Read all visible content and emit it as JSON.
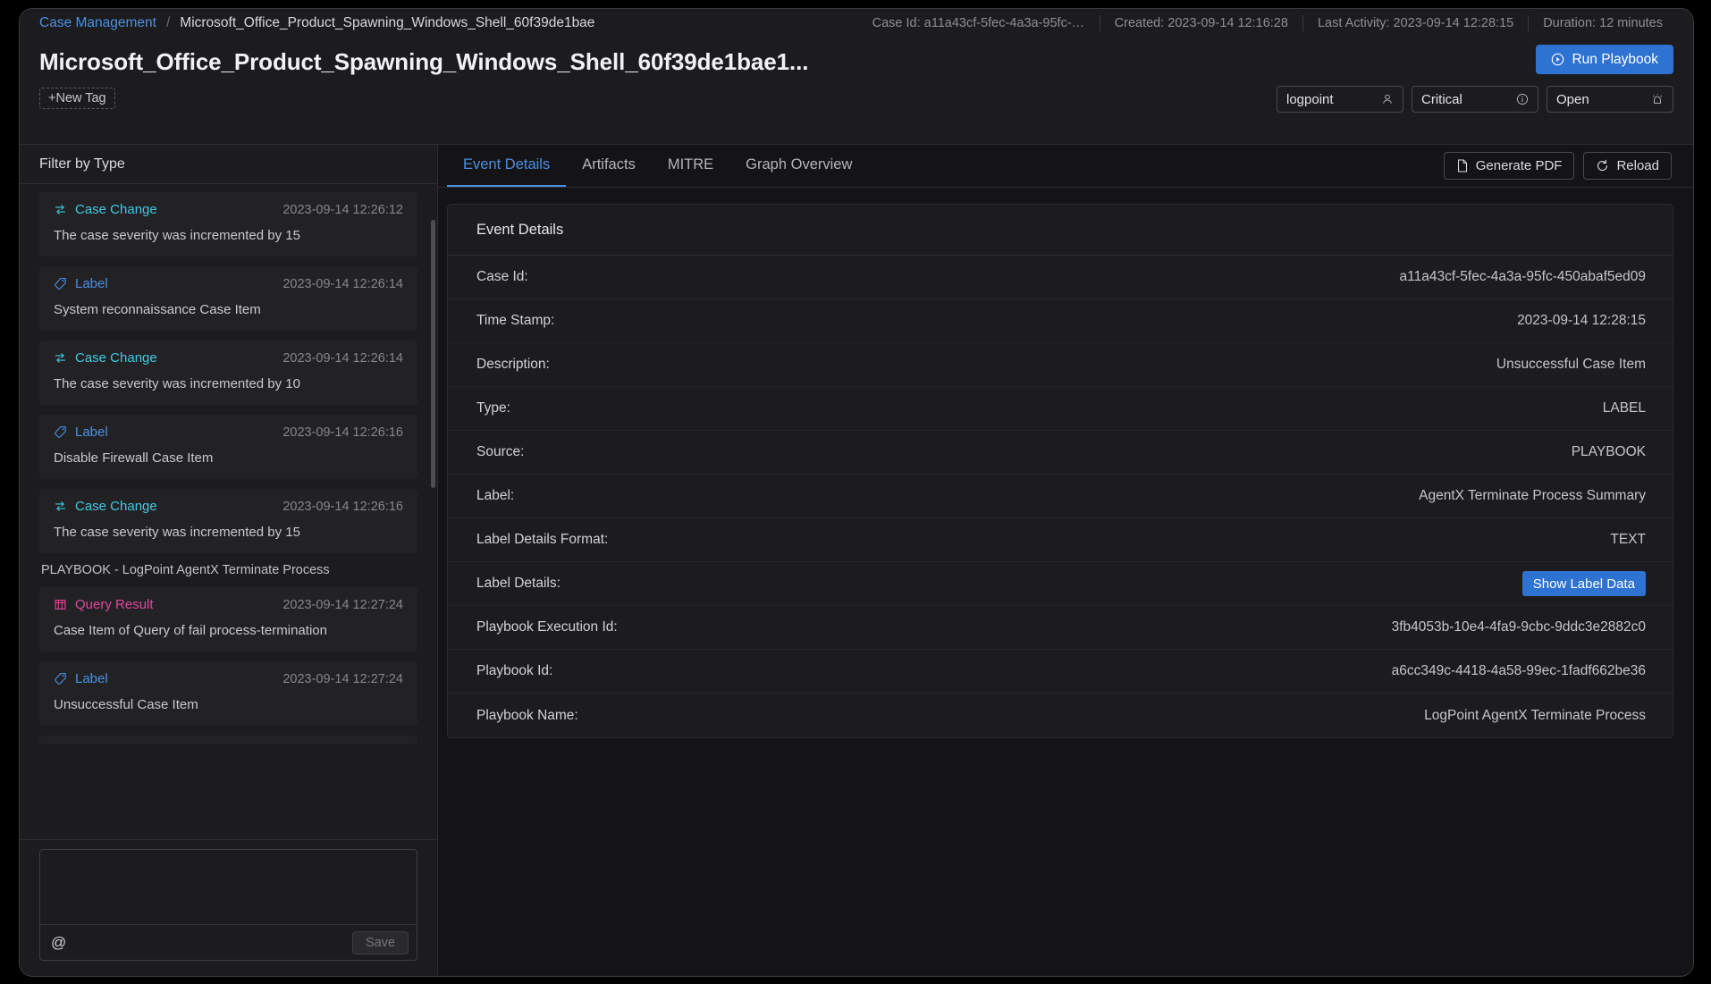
{
  "breadcrumb": {
    "root_label": "Case Management",
    "separator": "/",
    "current_label": "Microsoft_Office_Product_Spawning_Windows_Shell_60f39de1bae"
  },
  "header_meta": {
    "case_id": "Case Id: a11a43cf-5fec-4a3a-95fc-4...",
    "created": "Created: 2023-09-14 12:16:28",
    "last_activity": "Last Activity: 2023-09-14 12:28:15",
    "duration": "Duration: 12 minutes"
  },
  "title": {
    "text": "Microsoft_Office_Product_Spawning_Windows_Shell_60f39de1bae1...",
    "new_tag_label": "+New Tag"
  },
  "actions": {
    "run_playbook_label": "Run Playbook",
    "run_playbook_icon": "play-circle-icon",
    "accent_color": "#2e72d2"
  },
  "selectors": [
    {
      "name": "assignee",
      "value": "logpoint",
      "icon": "user-icon"
    },
    {
      "name": "severity",
      "value": "Critical",
      "icon": "info-circle-icon"
    },
    {
      "name": "status",
      "value": "Open",
      "icon": "alarm-icon"
    }
  ],
  "sidebar": {
    "filter_header": "Filter by Type",
    "group_title": "PLAYBOOK - LogPoint AgentX Terminate Process",
    "items": [
      {
        "type": "Case Change",
        "type_class": "casechange",
        "icon": "swap-icon",
        "time": "2023-09-14 12:26:12",
        "description": "The case severity was incremented by 15"
      },
      {
        "type": "Label",
        "type_class": "label",
        "icon": "tag-icon",
        "time": "2023-09-14 12:26:14",
        "description": "System reconnaissance Case Item"
      },
      {
        "type": "Case Change",
        "type_class": "casechange",
        "icon": "swap-icon",
        "time": "2023-09-14 12:26:14",
        "description": "The case severity was incremented by 10"
      },
      {
        "type": "Label",
        "type_class": "label",
        "icon": "tag-icon",
        "time": "2023-09-14 12:26:16",
        "description": "Disable Firewall Case Item"
      },
      {
        "type": "Case Change",
        "type_class": "casechange",
        "icon": "swap-icon",
        "time": "2023-09-14 12:26:16",
        "description": "The case severity was incremented by 15"
      }
    ],
    "group_items": [
      {
        "type": "Query Result",
        "type_class": "query",
        "icon": "table-icon",
        "time": "2023-09-14 12:27:24",
        "description": "Case Item of Query of fail process-termination"
      },
      {
        "type": "Label",
        "type_class": "label",
        "icon": "tag-icon",
        "time": "2023-09-14 12:27:24",
        "description": "Unsuccessful Case Item"
      }
    ],
    "composer": {
      "value": "",
      "placeholder": "",
      "mention_label": "@",
      "save_label": "Save"
    }
  },
  "main": {
    "tabs": [
      {
        "label": "Event Details",
        "active": true
      },
      {
        "label": "Artifacts",
        "active": false
      },
      {
        "label": "MITRE",
        "active": false
      },
      {
        "label": "Graph Overview",
        "active": false
      }
    ],
    "tab_actions": [
      {
        "label": "Generate PDF",
        "icon": "file-pdf-icon"
      },
      {
        "label": "Reload",
        "icon": "refresh-icon"
      }
    ],
    "card_title": "Event Details",
    "rows": [
      {
        "key": "Case Id:",
        "value": "a11a43cf-5fec-4a3a-95fc-450abaf5ed09"
      },
      {
        "key": "Time Stamp:",
        "value": "2023-09-14 12:28:15"
      },
      {
        "key": "Description:",
        "value": "Unsuccessful Case Item"
      },
      {
        "key": "Type:",
        "value": "LABEL"
      },
      {
        "key": "Source:",
        "value": "PLAYBOOK"
      },
      {
        "key": "Label:",
        "value": "AgentX Terminate Process Summary"
      },
      {
        "key": "Label Details Format:",
        "value": "TEXT"
      },
      {
        "key": "Label Details:",
        "value": "",
        "button": "Show Label Data"
      },
      {
        "key": "Playbook Execution Id:",
        "value": "3fb4053b-10e4-4fa9-9cbc-9ddc3e2882c0"
      },
      {
        "key": "Playbook Id:",
        "value": "a6cc349c-4418-4a58-99ec-1fadf662be36"
      },
      {
        "key": "Playbook Name:",
        "value": "LogPoint AgentX Terminate Process"
      }
    ]
  }
}
